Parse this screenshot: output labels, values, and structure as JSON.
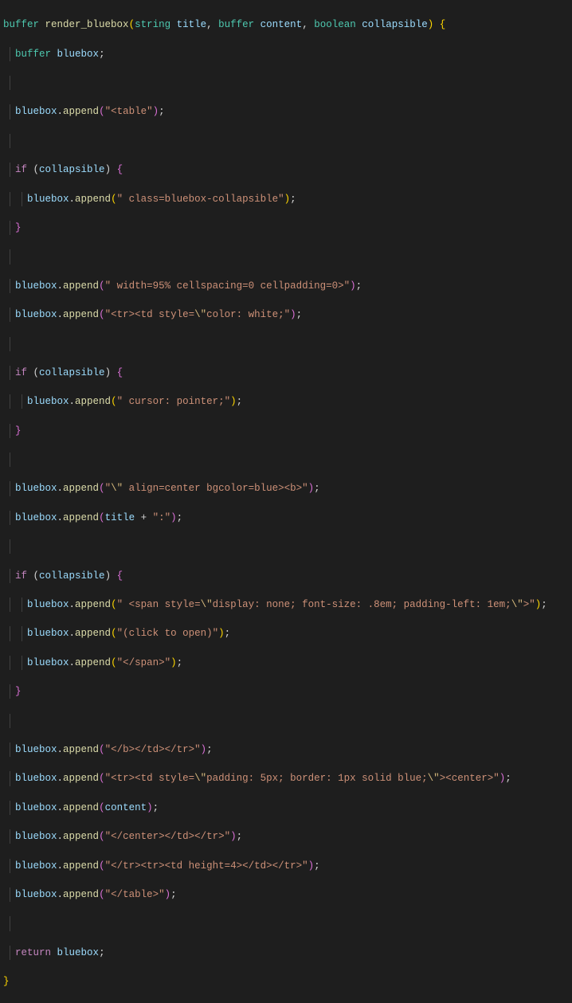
{
  "code": {
    "l1": {
      "a": "buffer",
      "b": " ",
      "c": "render_bluebox",
      "d": "(",
      "e": "string",
      "f": " ",
      "g": "title",
      "h": ", ",
      "i": "buffer",
      "j": " ",
      "k": "content",
      "l": ", ",
      "m": "boolean",
      "n": " ",
      "o": "collapsible",
      "p": ") ",
      "q": "{"
    },
    "l2": {
      "a": "  ",
      "b": "buffer",
      "c": " ",
      "d": "bluebox",
      "e": ";"
    },
    "l4": {
      "a": "  ",
      "b": "bluebox",
      "c": ".",
      "d": "append",
      "e": "(",
      "f": "\"<table\"",
      "g": ")",
      "h": ";"
    },
    "l6": {
      "a": "  ",
      "b": "if",
      "c": " (",
      "d": "collapsible",
      "e": ") ",
      "f": "{"
    },
    "l7": {
      "a": "    ",
      "b": "bluebox",
      "c": ".",
      "d": "append",
      "e": "(",
      "f": "\" class=bluebox-collapsible\"",
      "g": ")",
      "h": ";"
    },
    "l8": {
      "a": "  ",
      "b": "}"
    },
    "l10": {
      "a": "  ",
      "b": "bluebox",
      "c": ".",
      "d": "append",
      "e": "(",
      "f": "\" width=95% cellspacing=0 cellpadding=0>\"",
      "g": ")",
      "h": ";"
    },
    "l11": {
      "a": "  ",
      "b": "bluebox",
      "c": ".",
      "d": "append",
      "e": "(",
      "f1": "\"<tr><td style=",
      "esc": "\\\"",
      "f2": "color: white;\"",
      "g": ")",
      "h": ";"
    },
    "l13": {
      "a": "  ",
      "b": "if",
      "c": " (",
      "d": "collapsible",
      "e": ") ",
      "f": "{"
    },
    "l14": {
      "a": "    ",
      "b": "bluebox",
      "c": ".",
      "d": "append",
      "e": "(",
      "f": "\" cursor: pointer;\"",
      "g": ")",
      "h": ";"
    },
    "l15": {
      "a": "  ",
      "b": "}"
    },
    "l17": {
      "a": "  ",
      "b": "bluebox",
      "c": ".",
      "d": "append",
      "e": "(",
      "f1": "\"",
      "esc": "\\\"",
      "f2": " align=center bgcolor=blue><b>\"",
      "g": ")",
      "h": ";"
    },
    "l18": {
      "a": "  ",
      "b": "bluebox",
      "c": ".",
      "d": "append",
      "e": "(",
      "f": "title",
      "g": " + ",
      "h": "\":\"",
      "i": ")",
      "j": ";"
    },
    "l20": {
      "a": "  ",
      "b": "if",
      "c": " (",
      "d": "collapsible",
      "e": ") ",
      "f": "{"
    },
    "l21": {
      "a": "    ",
      "b": "bluebox",
      "c": ".",
      "d": "append",
      "e": "(",
      "f1": "\" <span style=",
      "esc1": "\\\"",
      "f2": "display: none; font-size: .8em; padding-left: 1em;",
      "esc2": "\\\"",
      "f3": ">\"",
      "g": ")",
      "h": ";"
    },
    "l22": {
      "a": "    ",
      "b": "bluebox",
      "c": ".",
      "d": "append",
      "e": "(",
      "f": "\"(click to open)\"",
      "g": ")",
      "h": ";"
    },
    "l23": {
      "a": "    ",
      "b": "bluebox",
      "c": ".",
      "d": "append",
      "e": "(",
      "f": "\"</span>\"",
      "g": ")",
      "h": ";"
    },
    "l24": {
      "a": "  ",
      "b": "}"
    },
    "l26": {
      "a": "  ",
      "b": "bluebox",
      "c": ".",
      "d": "append",
      "e": "(",
      "f": "\"</b></td></tr>\"",
      "g": ")",
      "h": ";"
    },
    "l27": {
      "a": "  ",
      "b": "bluebox",
      "c": ".",
      "d": "append",
      "e": "(",
      "f1": "\"<tr><td style=",
      "esc1": "\\\"",
      "f2": "padding: 5px; border: 1px solid blue;",
      "esc2": "\\\"",
      "f3": "><center>\"",
      "g": ")",
      "h": ";"
    },
    "l28": {
      "a": "  ",
      "b": "bluebox",
      "c": ".",
      "d": "append",
      "e": "(",
      "f": "content",
      "g": ")",
      "h": ";"
    },
    "l29": {
      "a": "  ",
      "b": "bluebox",
      "c": ".",
      "d": "append",
      "e": "(",
      "f": "\"</center></td></tr>\"",
      "g": ")",
      "h": ";"
    },
    "l30": {
      "a": "  ",
      "b": "bluebox",
      "c": ".",
      "d": "append",
      "e": "(",
      "f": "\"</tr><tr><td height=4></td></tr>\"",
      "g": ")",
      "h": ";"
    },
    "l31": {
      "a": "  ",
      "b": "bluebox",
      "c": ".",
      "d": "append",
      "e": "(",
      "f": "\"</table>\"",
      "g": ")",
      "h": ";"
    },
    "l33": {
      "a": "  ",
      "b": "return",
      "c": " ",
      "d": "bluebox",
      "e": ";"
    },
    "l34": {
      "a": "}"
    }
  }
}
